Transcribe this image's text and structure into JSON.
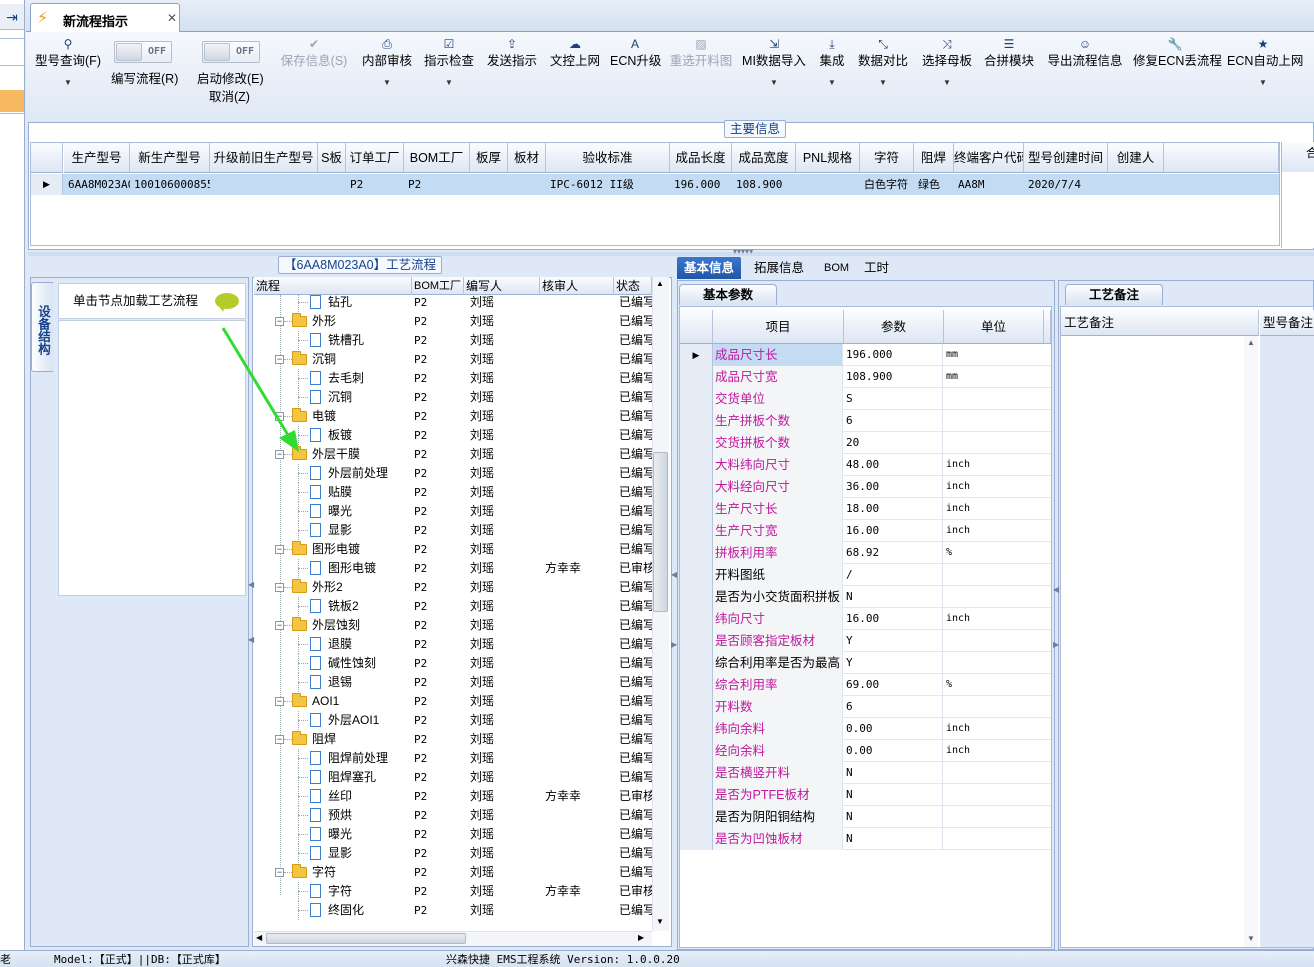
{
  "window": {
    "tab_title": "新流程指示"
  },
  "ribbon": {
    "model_query": "型号查询(F)",
    "write_flow": "编写流程(R)",
    "start_modify": "启动修改(E)",
    "cancel": "取消(Z)",
    "toggle_off": "OFF",
    "buttons": [
      "保存信息(S)",
      "内部审核",
      "指示检查",
      "发送指示",
      "文控上网",
      "ECN升级",
      "重选开料图",
      "MI数据导入",
      "集成",
      "数据对比",
      "选择母板",
      "合拼模块",
      "导出流程信息",
      "修复ECN丢流程",
      "ECN自动上网"
    ]
  },
  "main_info": {
    "title": "主要信息",
    "columns": [
      "生产型号",
      "新生产型号",
      "升级前旧生产型号",
      "S板",
      "订单工厂",
      "BOM工厂",
      "板厚",
      "板材",
      "验收标准",
      "成品长度",
      "成品宽度",
      "PNL规格",
      "字符",
      "阻焊",
      "终端客户代码",
      "型号创建时间",
      "创建人"
    ],
    "row": [
      "6AA8M023A0",
      "10010600085563",
      "",
      "",
      "P2",
      "P2",
      "",
      "",
      "IPC-6012 II级",
      "196.000",
      "108.900",
      "",
      "白色字符",
      "绿色",
      "AA8M",
      "2020/7/4",
      ""
    ],
    "right_header": "合"
  },
  "device": {
    "tab": "设备结构",
    "hint": "单击节点加载工艺流程"
  },
  "process": {
    "title": "【6AA8M023A0】工艺流程",
    "columns": [
      "流程",
      "BOM工厂",
      "编写人",
      "核审人",
      "状态"
    ],
    "rows": [
      {
        "level": 2,
        "type": "doc",
        "name": "钻孔",
        "bom": "P2",
        "writer": "刘瑶",
        "reviewer": "",
        "status": "已编写"
      },
      {
        "level": 1,
        "type": "folder",
        "name": "外形",
        "bom": "P2",
        "writer": "刘瑶",
        "reviewer": "",
        "status": "已编写"
      },
      {
        "level": 2,
        "type": "doc",
        "name": "铣槽孔",
        "bom": "P2",
        "writer": "刘瑶",
        "reviewer": "",
        "status": "已编写"
      },
      {
        "level": 1,
        "type": "folder",
        "name": "沉铜",
        "bom": "P2",
        "writer": "刘瑶",
        "reviewer": "",
        "status": "已编写"
      },
      {
        "level": 2,
        "type": "doc",
        "name": "去毛刺",
        "bom": "P2",
        "writer": "刘瑶",
        "reviewer": "",
        "status": "已编写"
      },
      {
        "level": 2,
        "type": "doc",
        "name": "沉铜",
        "bom": "P2",
        "writer": "刘瑶",
        "reviewer": "",
        "status": "已编写"
      },
      {
        "level": 1,
        "type": "folder",
        "name": "电镀",
        "bom": "P2",
        "writer": "刘瑶",
        "reviewer": "",
        "status": "已编写"
      },
      {
        "level": 2,
        "type": "doc",
        "name": "板镀",
        "bom": "P2",
        "writer": "刘瑶",
        "reviewer": "",
        "status": "已编写"
      },
      {
        "level": 1,
        "type": "folder",
        "name": "外层干膜",
        "bom": "P2",
        "writer": "刘瑶",
        "reviewer": "",
        "status": "已编写"
      },
      {
        "level": 2,
        "type": "doc",
        "name": "外层前处理",
        "bom": "P2",
        "writer": "刘瑶",
        "reviewer": "",
        "status": "已编写"
      },
      {
        "level": 2,
        "type": "doc",
        "name": "贴膜",
        "bom": "P2",
        "writer": "刘瑶",
        "reviewer": "",
        "status": "已编写"
      },
      {
        "level": 2,
        "type": "doc",
        "name": "曝光",
        "bom": "P2",
        "writer": "刘瑶",
        "reviewer": "",
        "status": "已编写"
      },
      {
        "level": 2,
        "type": "doc",
        "name": "显影",
        "bom": "P2",
        "writer": "刘瑶",
        "reviewer": "",
        "status": "已编写"
      },
      {
        "level": 1,
        "type": "folder",
        "name": "图形电镀",
        "bom": "P2",
        "writer": "刘瑶",
        "reviewer": "",
        "status": "已编写"
      },
      {
        "level": 2,
        "type": "doc",
        "name": "图形电镀",
        "bom": "P2",
        "writer": "刘瑶",
        "reviewer": "方幸幸",
        "status": "已审核"
      },
      {
        "level": 1,
        "type": "folder",
        "name": "外形2",
        "bom": "P2",
        "writer": "刘瑶",
        "reviewer": "",
        "status": "已编写"
      },
      {
        "level": 2,
        "type": "doc",
        "name": "铣板2",
        "bom": "P2",
        "writer": "刘瑶",
        "reviewer": "",
        "status": "已编写"
      },
      {
        "level": 1,
        "type": "folder",
        "name": "外层蚀刻",
        "bom": "P2",
        "writer": "刘瑶",
        "reviewer": "",
        "status": "已编写"
      },
      {
        "level": 2,
        "type": "doc",
        "name": "退膜",
        "bom": "P2",
        "writer": "刘瑶",
        "reviewer": "",
        "status": "已编写"
      },
      {
        "level": 2,
        "type": "doc",
        "name": "碱性蚀刻",
        "bom": "P2",
        "writer": "刘瑶",
        "reviewer": "",
        "status": "已编写"
      },
      {
        "level": 2,
        "type": "doc",
        "name": "退锡",
        "bom": "P2",
        "writer": "刘瑶",
        "reviewer": "",
        "status": "已编写"
      },
      {
        "level": 1,
        "type": "folder",
        "name": "AOI1",
        "bom": "P2",
        "writer": "刘瑶",
        "reviewer": "",
        "status": "已编写"
      },
      {
        "level": 2,
        "type": "doc",
        "name": "外层AOI1",
        "bom": "P2",
        "writer": "刘瑶",
        "reviewer": "",
        "status": "已编写"
      },
      {
        "level": 1,
        "type": "folder",
        "name": "阻焊",
        "bom": "P2",
        "writer": "刘瑶",
        "reviewer": "",
        "status": "已编写"
      },
      {
        "level": 2,
        "type": "doc",
        "name": "阻焊前处理",
        "bom": "P2",
        "writer": "刘瑶",
        "reviewer": "",
        "status": "已编写"
      },
      {
        "level": 2,
        "type": "doc",
        "name": "阻焊塞孔",
        "bom": "P2",
        "writer": "刘瑶",
        "reviewer": "",
        "status": "已编写"
      },
      {
        "level": 2,
        "type": "doc",
        "name": "丝印",
        "bom": "P2",
        "writer": "刘瑶",
        "reviewer": "方幸幸",
        "status": "已审核"
      },
      {
        "level": 2,
        "type": "doc",
        "name": "预烘",
        "bom": "P2",
        "writer": "刘瑶",
        "reviewer": "",
        "status": "已编写"
      },
      {
        "level": 2,
        "type": "doc",
        "name": "曝光",
        "bom": "P2",
        "writer": "刘瑶",
        "reviewer": "",
        "status": "已编写"
      },
      {
        "level": 2,
        "type": "doc",
        "name": "显影",
        "bom": "P2",
        "writer": "刘瑶",
        "reviewer": "",
        "status": "已编写"
      },
      {
        "level": 1,
        "type": "folder",
        "name": "字符",
        "bom": "P2",
        "writer": "刘瑶",
        "reviewer": "",
        "status": "已编写"
      },
      {
        "level": 2,
        "type": "doc",
        "name": "字符",
        "bom": "P2",
        "writer": "刘瑶",
        "reviewer": "方幸幸",
        "status": "已审核"
      },
      {
        "level": 2,
        "type": "doc",
        "name": "终固化",
        "bom": "P2",
        "writer": "刘瑶",
        "reviewer": "",
        "status": "已编写"
      }
    ]
  },
  "info_tabs": [
    "基本信息",
    "拓展信息",
    "BOM",
    "工时"
  ],
  "basic": {
    "tab": "基本参数",
    "columns": [
      "项目",
      "参数",
      "单位"
    ],
    "rows": [
      {
        "k": "成品尺寸长",
        "v": "196.000",
        "u": "mm",
        "pink": true
      },
      {
        "k": "成品尺寸宽",
        "v": "108.900",
        "u": "mm",
        "pink": true
      },
      {
        "k": "交货单位",
        "v": "S",
        "u": "",
        "pink": true
      },
      {
        "k": "生产拼板个数",
        "v": "6",
        "u": "",
        "pink": true
      },
      {
        "k": "交货拼板个数",
        "v": "20",
        "u": "",
        "pink": true
      },
      {
        "k": "大料纬向尺寸",
        "v": "48.00",
        "u": "inch",
        "pink": true
      },
      {
        "k": "大料经向尺寸",
        "v": "36.00",
        "u": "inch",
        "pink": true
      },
      {
        "k": "生产尺寸长",
        "v": "18.00",
        "u": "inch",
        "pink": true
      },
      {
        "k": "生产尺寸宽",
        "v": "16.00",
        "u": "inch",
        "pink": true
      },
      {
        "k": "拼板利用率",
        "v": "68.92",
        "u": "%",
        "pink": true
      },
      {
        "k": "开料图纸",
        "v": "/",
        "u": "",
        "pink": false
      },
      {
        "k": "是否为小交货面积拼板",
        "v": "N",
        "u": "",
        "pink": false
      },
      {
        "k": "纬向尺寸",
        "v": "16.00",
        "u": "inch",
        "pink": true
      },
      {
        "k": "是否顾客指定板材",
        "v": "Y",
        "u": "",
        "pink": true
      },
      {
        "k": "综合利用率是否为最高",
        "v": "Y",
        "u": "",
        "pink": false
      },
      {
        "k": "综合利用率",
        "v": "69.00",
        "u": "%",
        "pink": true
      },
      {
        "k": "开料数",
        "v": "6",
        "u": "",
        "pink": true
      },
      {
        "k": "纬向余料",
        "v": "0.00",
        "u": "inch",
        "pink": true
      },
      {
        "k": "经向余料",
        "v": "0.00",
        "u": "inch",
        "pink": true
      },
      {
        "k": "是否横竖开料",
        "v": "N",
        "u": "",
        "pink": true
      },
      {
        "k": "是否为PTFE板材",
        "v": "N",
        "u": "",
        "pink": true
      },
      {
        "k": "是否为阴阳铜结构",
        "v": "N",
        "u": "",
        "pink": false
      },
      {
        "k": "是否为凹蚀板材",
        "v": "N",
        "u": "",
        "pink": true
      }
    ]
  },
  "remark": {
    "tab": "工艺备注",
    "col1": "工艺备注",
    "col2": "型号备注"
  },
  "status_bar": {
    "left": "老",
    "model": "Model:【正式】||DB:【正式库】",
    "system": "兴森快捷 EMS工程系统 Version: 1.0.0.20"
  },
  "colors": {
    "accent": "#1f56a8",
    "pink_label": "#c0179f",
    "selected_row": "#c3dcf4",
    "arrow": "#2fdc2f"
  }
}
